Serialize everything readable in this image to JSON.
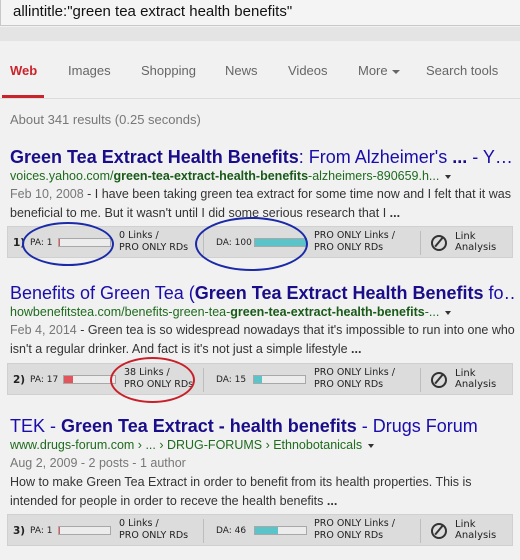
{
  "search": {
    "query": "allintitle:\"green tea extract health benefits\""
  },
  "tabs": [
    {
      "label": "Web",
      "active": true
    },
    {
      "label": "Images"
    },
    {
      "label": "Shopping"
    },
    {
      "label": "News"
    },
    {
      "label": "Videos"
    },
    {
      "label": "More"
    },
    {
      "label": "Search tools"
    }
  ],
  "stats": "About 341 results (0.25 seconds)",
  "results": [
    {
      "title_bold": "Green Tea Extract Health Benefits",
      "title_rest": ": From Alzheimer's ",
      "title_bold2": "...",
      "title_tail": " - Y…",
      "url_pre": "voices.yahoo.com/",
      "url_bold": "green-tea-extract-health-benefits",
      "url_post": "-alzheimers-890659.h...",
      "date": "Feb 10, 2008",
      "snippet": " - I have been taking green tea extract for some time now and I felt that it was beneficial to me. But it wasn't until I did some serious research that I ",
      "ellipsis": "...",
      "mozbar": {
        "rank": "1)",
        "pa_label": "PA: 1",
        "pa_value": 1,
        "links_line1": "0 Links /",
        "links_line2": "PRO ONLY RDs",
        "da_label": "DA: 100",
        "da_value": 100,
        "da_links_line1": "PRO ONLY Links /",
        "da_links_line2": "PRO ONLY RDs",
        "la_line1": "Link",
        "la_line2": "Analysis"
      }
    },
    {
      "title_pre": "Benefits of Green Tea (",
      "title_bold": "Green Tea Extract Health Benefits",
      "title_tail": " fo…",
      "url_pre": "howbenefitstea.com/benefits-green-tea-",
      "url_bold": "green-tea-extract-health-benefits",
      "url_post": "-...",
      "date": "Feb 4, 2014",
      "snippet": " - Green tea is so widespread nowadays that it's impossible to run into one who isn't a regular drinker. And fact is it's not just a simple lifestyle ",
      "ellipsis": "...",
      "mozbar": {
        "rank": "2)",
        "pa_label": "PA: 17",
        "pa_value": 17,
        "links_line1": "38 Links /",
        "links_line2": "PRO ONLY RDs",
        "da_label": "DA: 15",
        "da_value": 15,
        "da_links_line1": "PRO ONLY Links /",
        "da_links_line2": "PRO ONLY RDs",
        "la_line1": "Link",
        "la_line2": "Analysis"
      }
    },
    {
      "title_pre": "TEK - ",
      "title_bold": "Green Tea Extract - health benefits",
      "title_tail": " - Drugs Forum",
      "url_text": "www.drugs-forum.com › ... › DRUG-FORUMS › Ethnobotanicals",
      "meta": "Aug 2, 2009 - 2 posts - 1 author",
      "snippet": "How to make Green Tea Extract in order to benefit from its health properties. This is intended for people in order to receve the health benefits ",
      "ellipsis": "...",
      "mozbar": {
        "rank": "3)",
        "pa_label": "PA: 1",
        "pa_value": 1,
        "links_line1": "0 Links /",
        "links_line2": "PRO ONLY RDs",
        "da_label": "DA: 46",
        "da_value": 46,
        "da_links_line1": "PRO ONLY Links /",
        "da_links_line2": "PRO ONLY RDs",
        "la_line1": "Link",
        "la_line2": "Analysis"
      }
    }
  ],
  "colors": {
    "pa_fill": "#e2555d",
    "da_fill": "#5bc4c8",
    "active_tab": "#c9242b",
    "annotation_blue": "#1a2aa8",
    "annotation_red": "#c8202a"
  }
}
